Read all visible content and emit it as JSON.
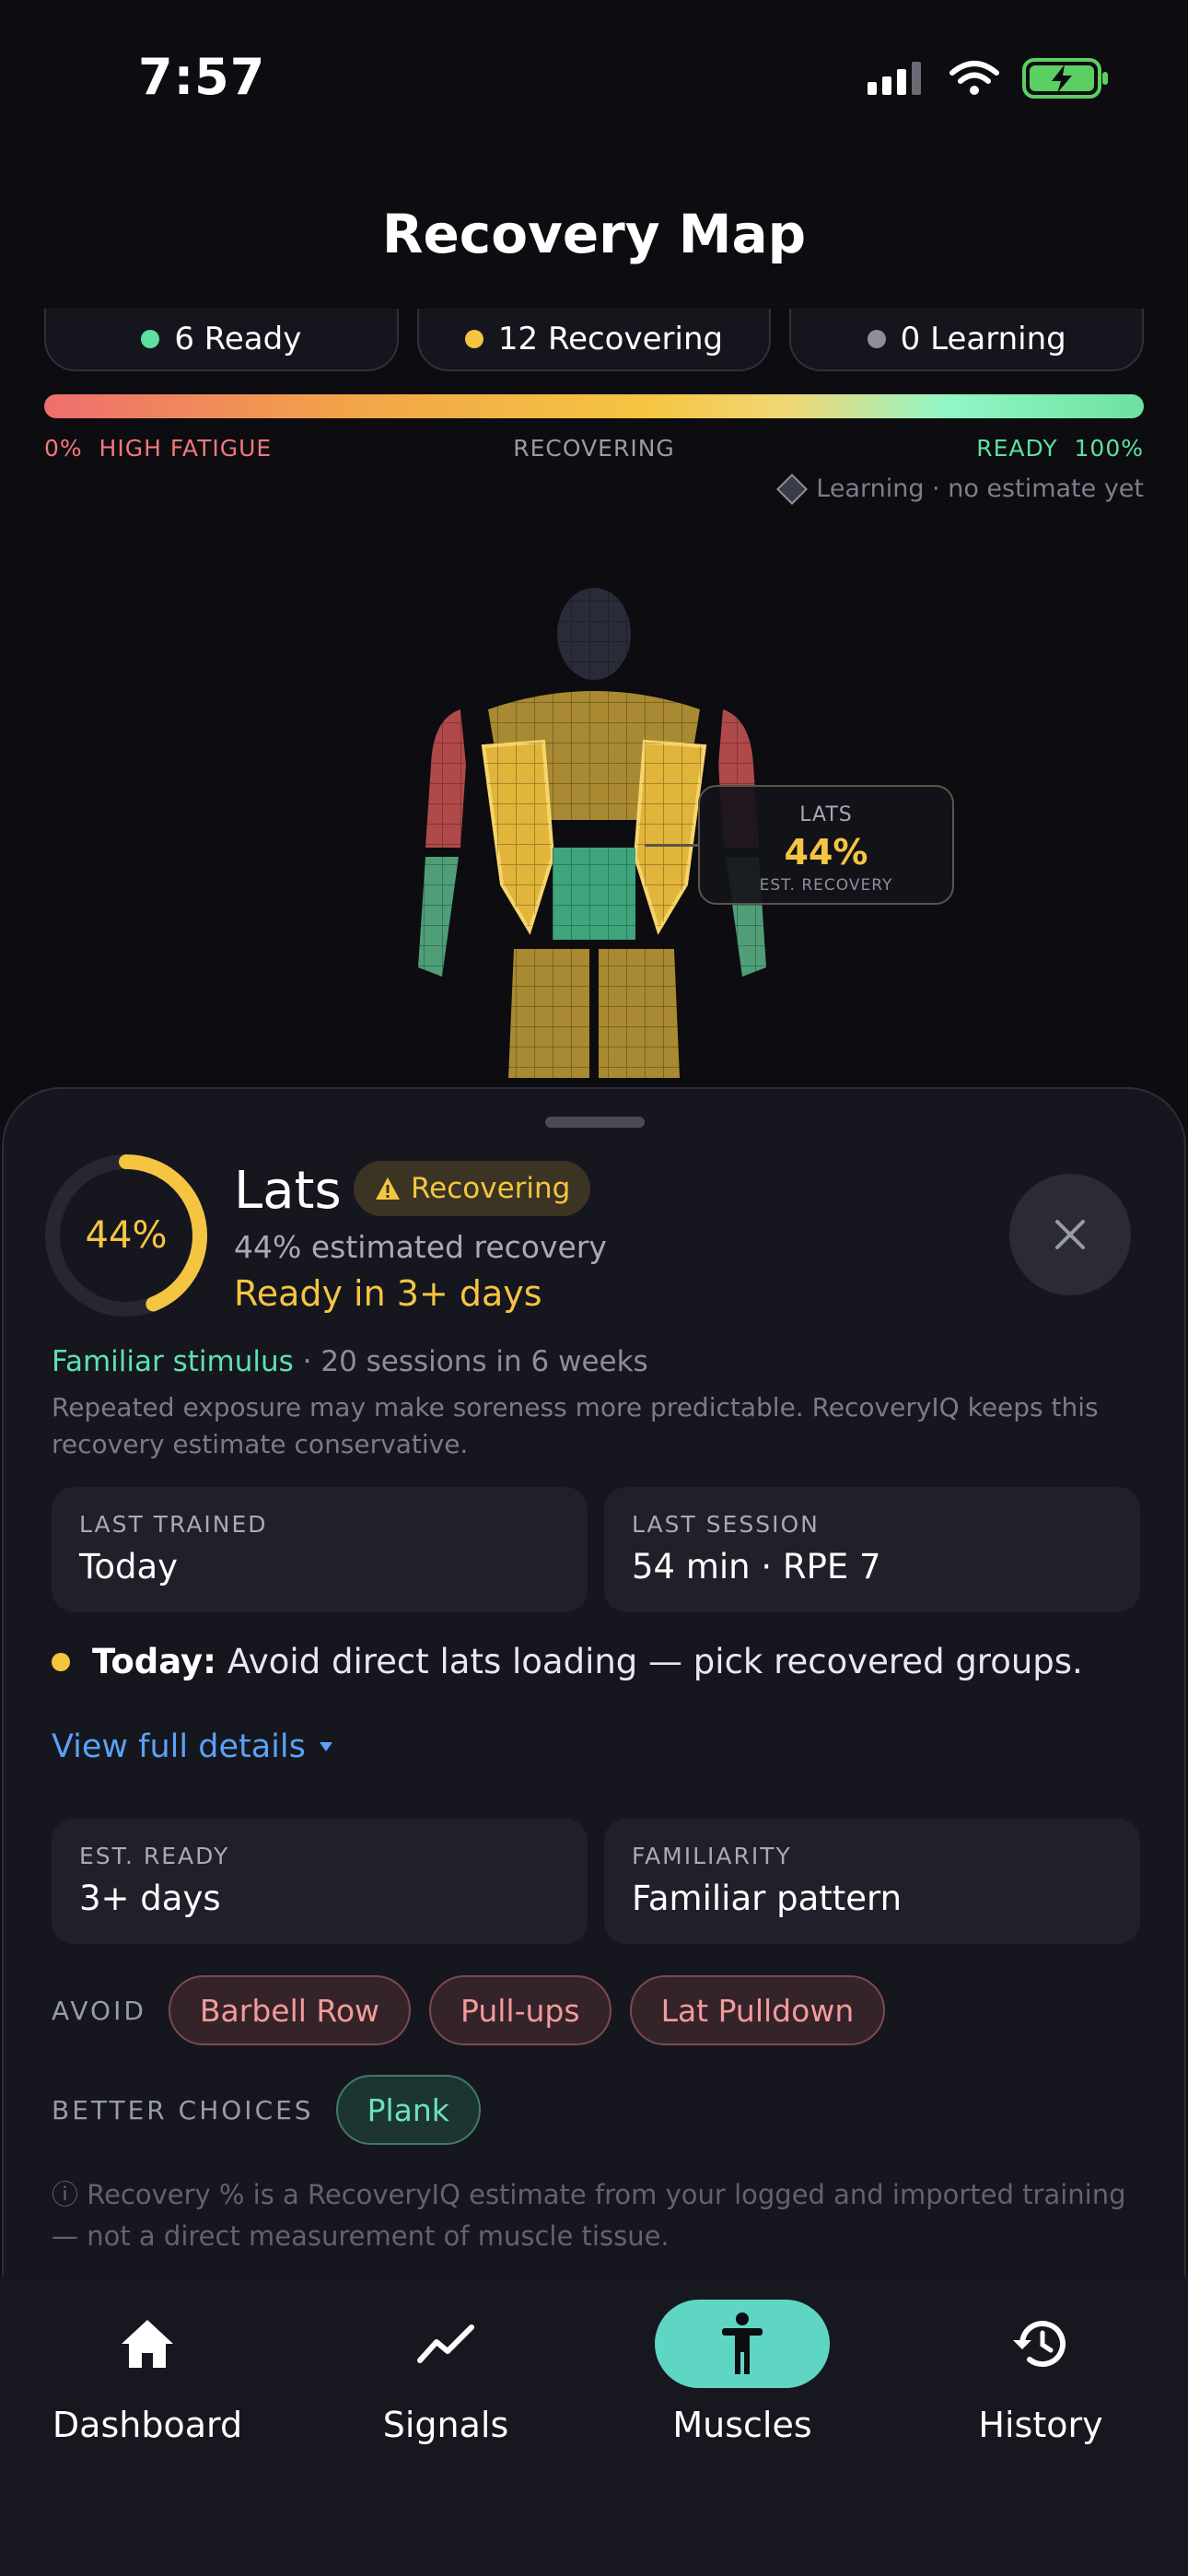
{
  "status_bar": {
    "time": "7:57"
  },
  "header": {
    "title": "Recovery Map"
  },
  "summary_chips": [
    {
      "label": "6 Ready",
      "color": "#5ee0a0"
    },
    {
      "label": "12 Recovering",
      "color": "#f5c542"
    },
    {
      "label": "0 Learning",
      "color": "#8d8e9a"
    }
  ],
  "legend": {
    "left": "0%  HIGH FATIGUE",
    "middle": "RECOVERING",
    "right": "READY  100%",
    "learning_note": "Learning · no estimate yet"
  },
  "tooltip": {
    "label": "LATS",
    "value": "44%",
    "sub": "EST. RECOVERY"
  },
  "detail": {
    "recovery_percent_label": "44%",
    "recovery_fraction": 0.44,
    "muscle_name": "Lats",
    "status_label": "Recovering",
    "estimated_line": "44% estimated recovery",
    "ready_line": "Ready in 3+ days",
    "stimulus_label": "Familiar stimulus",
    "stimulus_detail": " · 20 sessions in 6 weeks",
    "stimulus_description": "Repeated exposure may make soreness more predictable. RecoveryIQ keeps this recovery estimate conservative.",
    "last_trained_key": "LAST TRAINED",
    "last_trained_value": "Today",
    "last_session_key": "LAST SESSION",
    "last_session_value": "54 min · RPE 7",
    "today_bold": "Today:",
    "today_text": "Avoid direct lats loading — pick recovered groups.",
    "view_details": "View full details",
    "est_ready_key": "EST. READY",
    "est_ready_value": "3+ days",
    "familiarity_key": "FAMILIARITY",
    "familiarity_value": "Familiar pattern",
    "avoid_label": "AVOID",
    "avoid_items": [
      "Barbell Row",
      "Pull-ups",
      "Lat Pulldown"
    ],
    "better_label": "BETTER CHOICES",
    "better_items": [
      "Plank"
    ],
    "disclaimer": "ⓘ Recovery % is a RecoveryIQ estimate from your logged and imported training — not a direct measurement of muscle tissue."
  },
  "colors": {
    "accent_yellow": "#f5c542",
    "ready_green": "#5ee0a0",
    "fatigue_red": "#ee6e6e",
    "tab_active": "#5fd6c4",
    "link_blue": "#5aa2f5"
  },
  "tabs": [
    {
      "label": "Dashboard",
      "icon": "home-icon",
      "active": false
    },
    {
      "label": "Signals",
      "icon": "trend-icon",
      "active": false
    },
    {
      "label": "Muscles",
      "icon": "person-icon",
      "active": true
    },
    {
      "label": "History",
      "icon": "history-icon",
      "active": false
    }
  ]
}
